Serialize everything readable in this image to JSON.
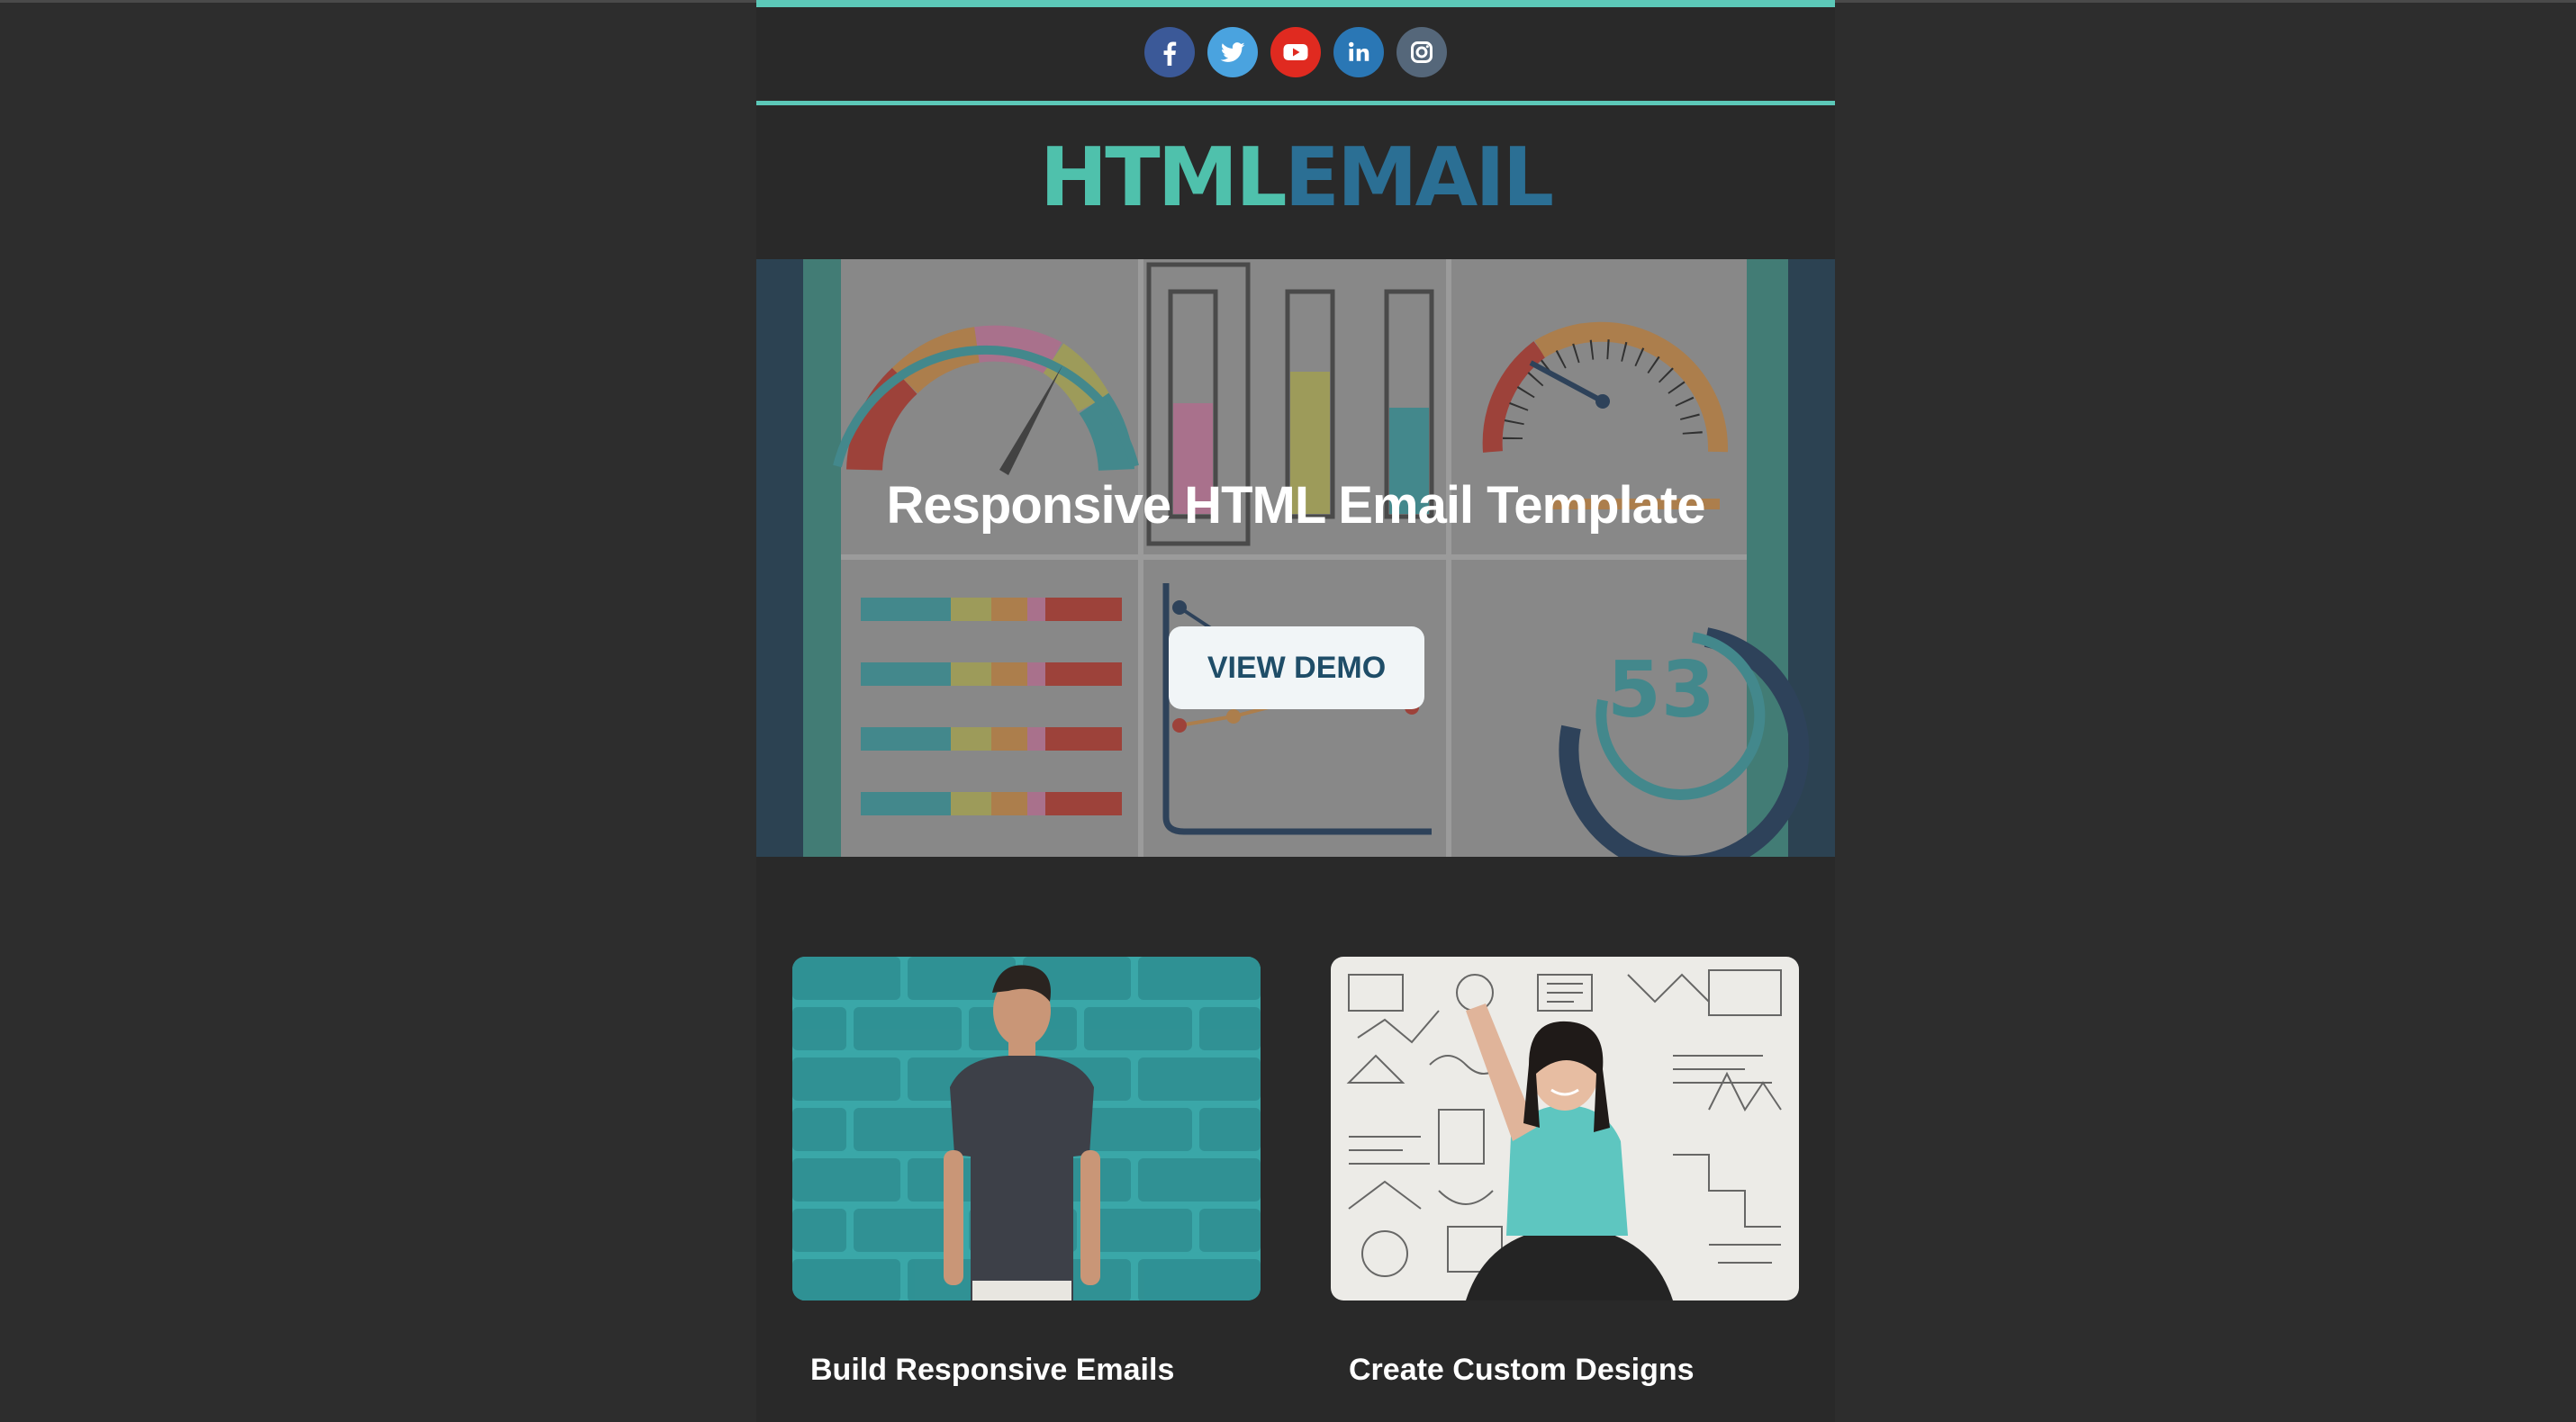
{
  "social": {
    "icons": [
      "facebook-icon",
      "twitter-icon",
      "youtube-icon",
      "linkedin-icon",
      "instagram-icon"
    ],
    "colors": {
      "facebook": "#3b5998",
      "twitter": "#4aa3df",
      "youtube": "#e02a20",
      "linkedin": "#2a77b5",
      "instagram": "#55677a"
    }
  },
  "logo": {
    "part1": "HTML",
    "part2": "EMAIL"
  },
  "hero": {
    "title": "Responsive HTML Email Template",
    "cta": "VIEW DEMO",
    "gauge_number": "53"
  },
  "cards": [
    {
      "title": "Build Responsive Emails",
      "image": "man-brick-wall-photo"
    },
    {
      "title": "Create Custom Designs",
      "image": "woman-whiteboard-photo"
    }
  ],
  "colors": {
    "accent": "#5cc8b8",
    "logo_teal": "#4fc1ac",
    "logo_blue": "#2b6f94",
    "button_text": "#1f4d68"
  }
}
